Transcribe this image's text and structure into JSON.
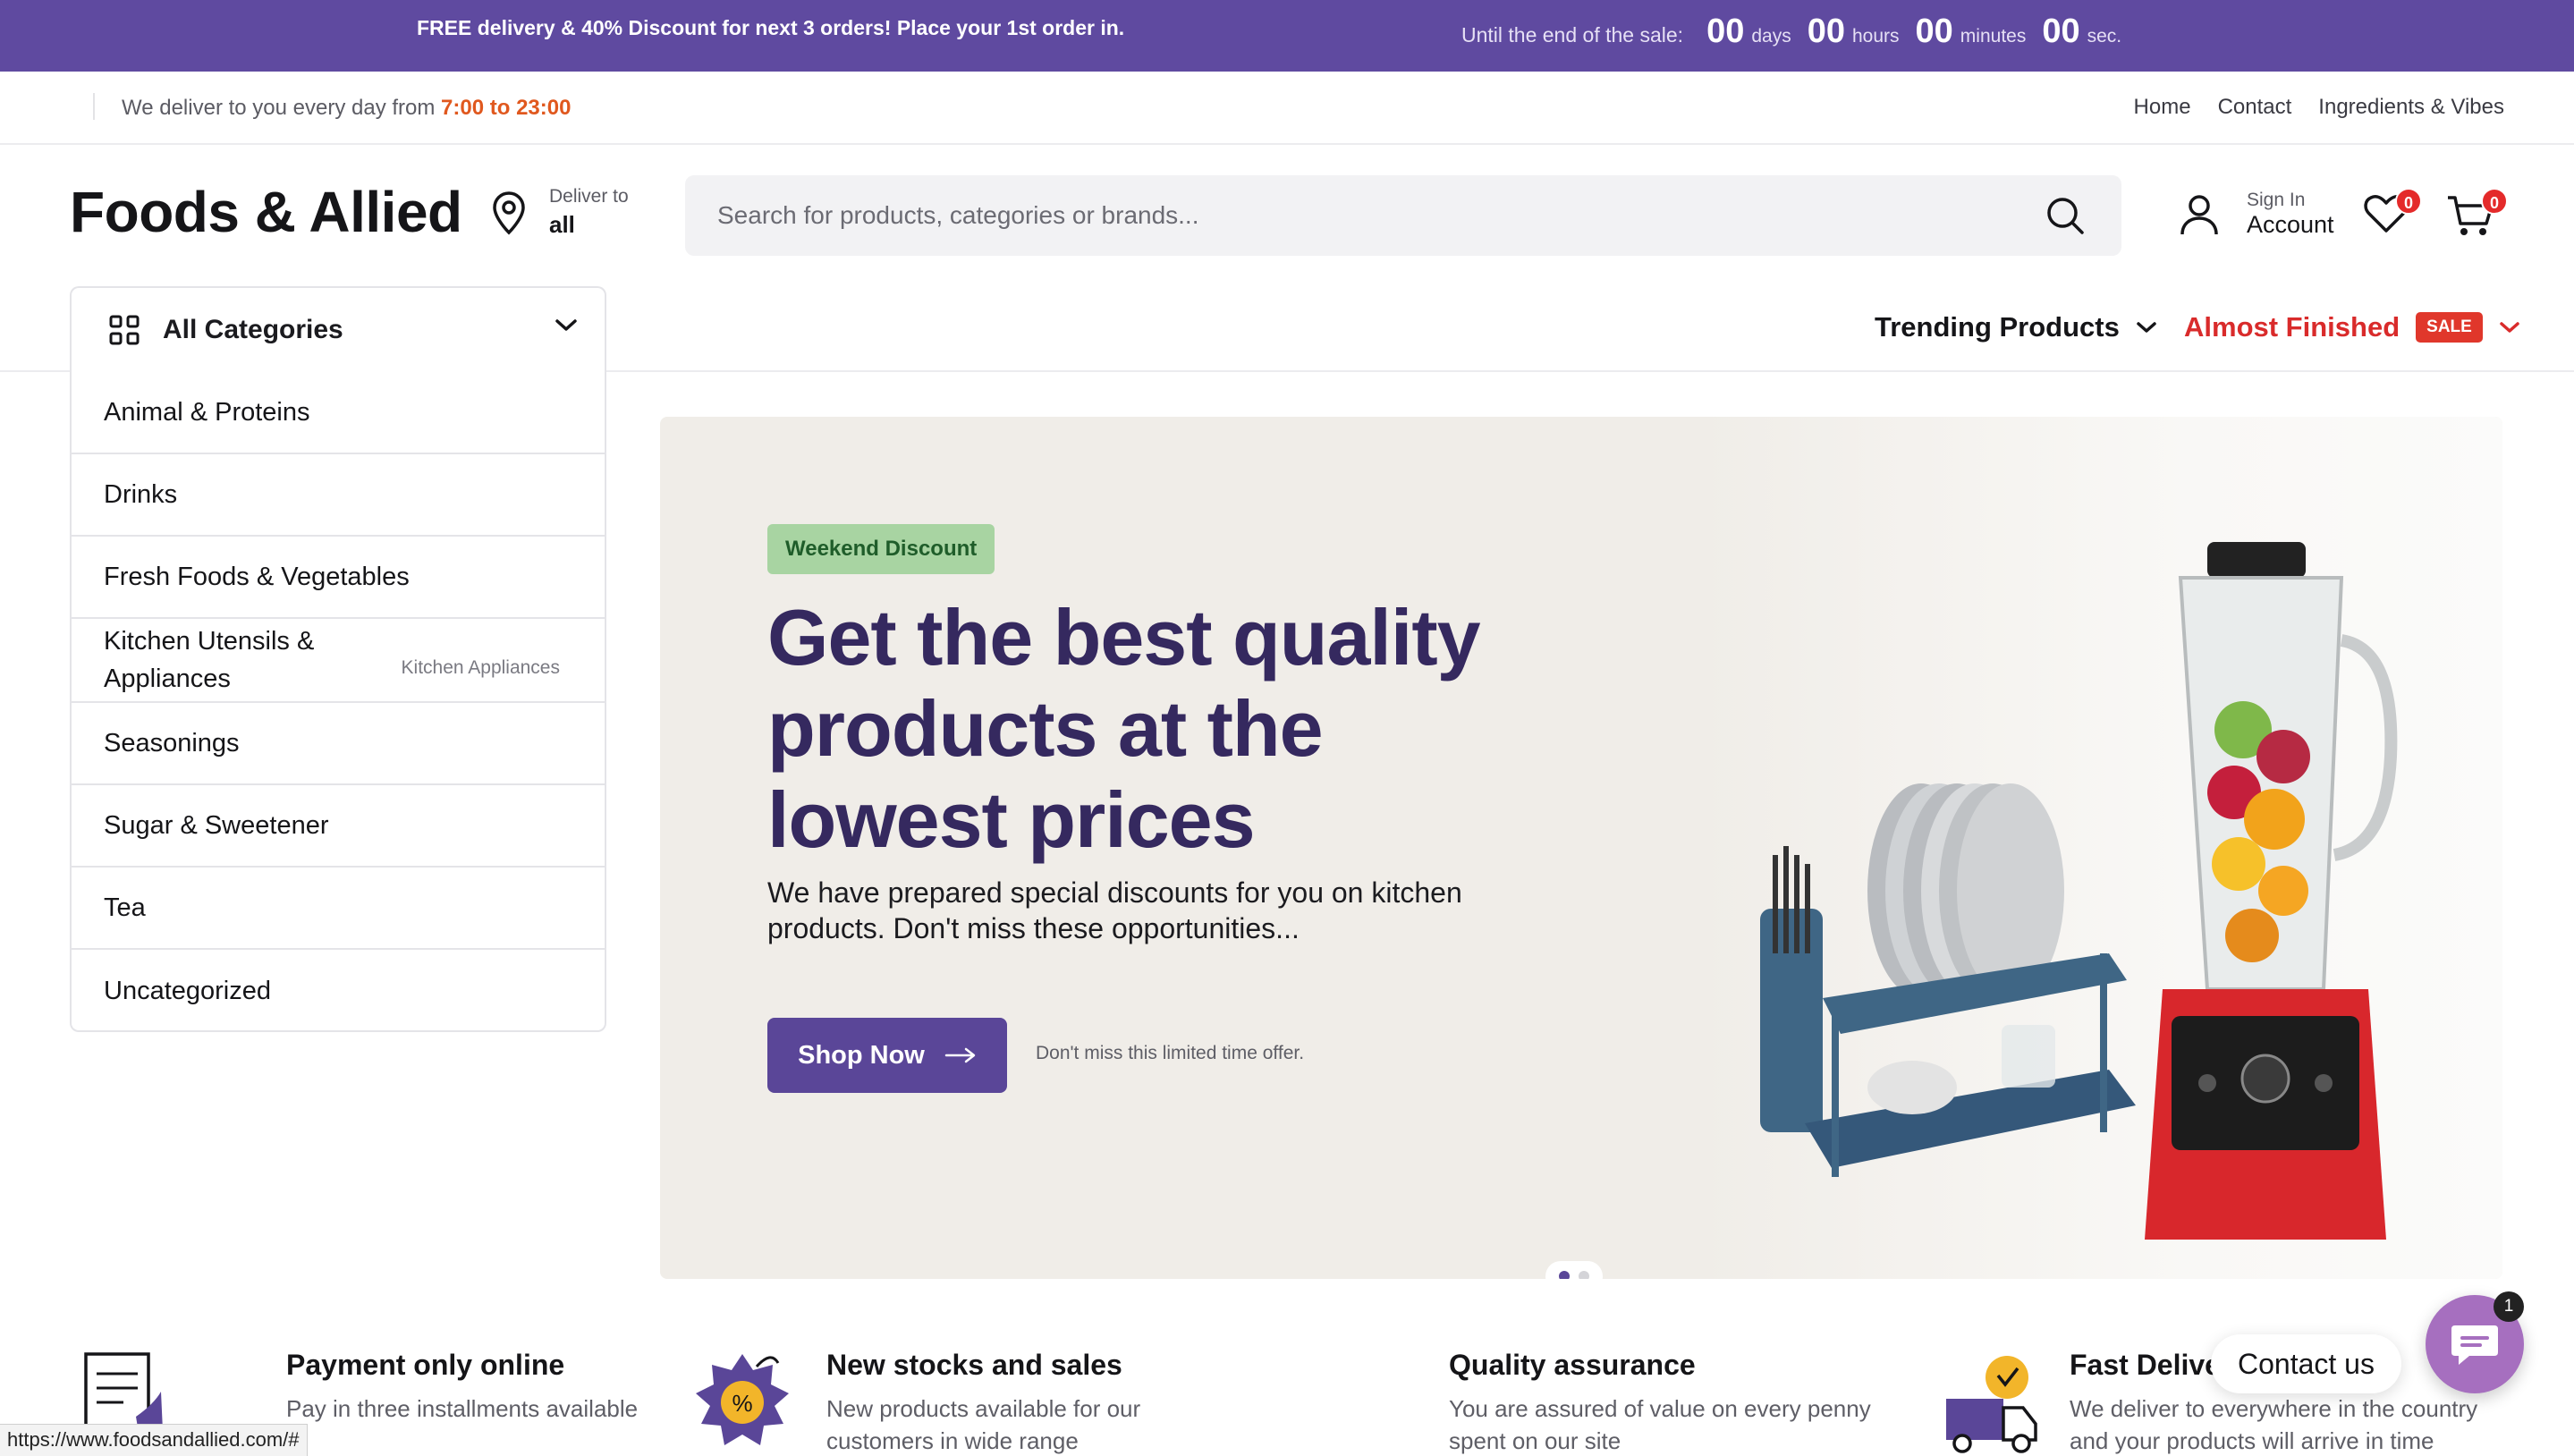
{
  "promo": {
    "text": "FREE delivery & 40% Discount for next 3 orders! Place your 1st order in.",
    "countdown_label": "Until the end of the sale:",
    "days": "00",
    "days_unit": "days",
    "hours": "00",
    "hours_unit": "hours",
    "minutes": "00",
    "minutes_unit": "minutes",
    "seconds": "00",
    "seconds_unit": "sec."
  },
  "infobar": {
    "deliver_prefix": "We deliver to you every day from ",
    "deliver_hours": "7:00 to 23:00",
    "links": [
      "Home",
      "Contact",
      "Ingredients & Vibes"
    ]
  },
  "header": {
    "logo": "Foods & Allied",
    "deliver_to_label": "Deliver to",
    "deliver_to_value": "all",
    "search_placeholder": "Search for products, categories or brands...",
    "sign_in_label": "Sign In",
    "account_label": "Account",
    "wishlist_count": "0",
    "cart_count": "0"
  },
  "nav": {
    "all_categories": "All Categories",
    "trending": "Trending Products",
    "almost_finished": "Almost Finished",
    "sale_badge": "SALE"
  },
  "categories": [
    {
      "label": "Animal & Proteins"
    },
    {
      "label": "Drinks"
    },
    {
      "label": "Fresh Foods & Vegetables"
    },
    {
      "label": "Kitchen Utensils & Appliances",
      "sub": "Kitchen Appliances"
    },
    {
      "label": "Seasonings"
    },
    {
      "label": "Sugar & Sweetener"
    },
    {
      "label": "Tea"
    },
    {
      "label": "Uncategorized"
    }
  ],
  "hero": {
    "tag": "Weekend Discount",
    "headline": "Get the best quality products at the lowest prices",
    "description": "We have prepared special discounts for you on kitchen products. Don't miss these opportunities...",
    "cta": "Shop Now",
    "note": "Don't miss this limited time offer.",
    "slides_total": 2,
    "slide_active": 1
  },
  "features": [
    {
      "title": "Payment only online",
      "desc": "Pay in three installments available"
    },
    {
      "title": "New stocks and sales",
      "desc": "New products available for our customers in wide range"
    },
    {
      "title": "Quality assurance",
      "desc": "You are assured of value on every penny spent on our site"
    },
    {
      "title": "Fast Delive",
      "desc": "We deliver to everywhere in the country and your products will arrive in time"
    }
  ],
  "contact": {
    "label": "Contact us",
    "count": "1"
  },
  "status_url": "https://www.foodsandallied.com/#",
  "colors": {
    "brand": "#5f4aa0",
    "headline": "#35295f",
    "accent": "#e0581e",
    "sale": "#e0372b"
  }
}
